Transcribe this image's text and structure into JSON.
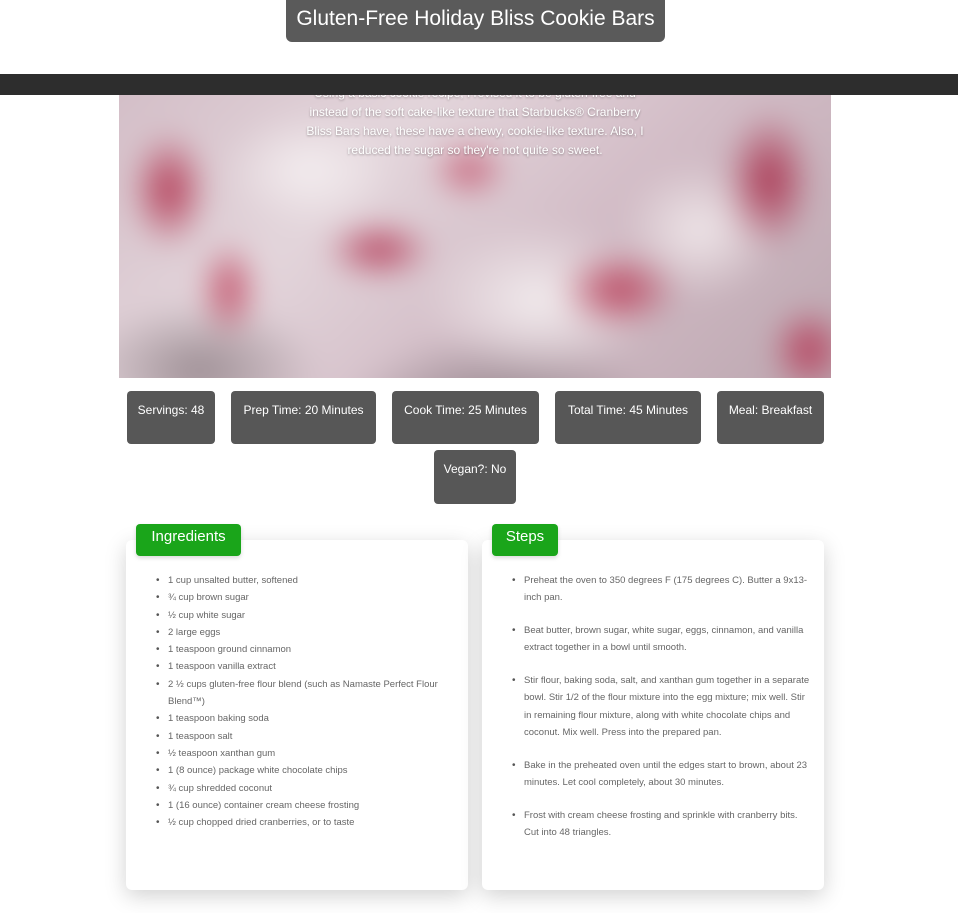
{
  "page_title": "Gluten-Free Holiday Bliss Cookie Bars",
  "description": "Using a basic cookie recipe, I revised it to be gluten-free and instead of the soft cake-like texture that Starbucks® Cranberry Bliss Bars have, these have a chewy, cookie-like texture. Also, I reduced the sugar so they're not quite so sweet.",
  "meta": [
    {
      "label": "Servings: 48"
    },
    {
      "label": "Prep Time: 20 Minutes"
    },
    {
      "label": "Cook Time: 25 Minutes"
    },
    {
      "label": "Total Time: 45 Minutes"
    },
    {
      "label": "Meal: Breakfast"
    },
    {
      "label": "Vegan?: No"
    }
  ],
  "ingredients": {
    "heading": "Ingredients",
    "items": [
      "1 cup unsalted butter, softened",
      "¾ cup brown sugar",
      "½ cup white sugar",
      "2 large eggs",
      "1 teaspoon ground cinnamon",
      "1 teaspoon vanilla extract",
      "2 ½ cups gluten-free flour blend (such as Namaste Perfect Flour Blend™)",
      "1 teaspoon baking soda",
      "1 teaspoon salt",
      "½ teaspoon xanthan gum",
      "1 (8 ounce) package white chocolate chips",
      "¾ cup shredded coconut",
      "1 (16 ounce) container cream cheese frosting",
      "½ cup chopped dried cranberries, or to taste"
    ]
  },
  "steps": {
    "heading": "Steps",
    "items": [
      "Preheat the oven to 350 degrees F (175 degrees C). Butter a 9x13-inch pan.",
      "Beat butter, brown sugar, white sugar, eggs, cinnamon, and vanilla extract together in a bowl until smooth.",
      "Stir flour, baking soda, salt, and xanthan gum together in a separate bowl. Stir 1/2 of the flour mixture into the egg mixture; mix well. Stir in remaining flour mixture, along with white chocolate chips and coconut. Mix well. Press into the prepared pan.",
      "Bake in the preheated oven until the edges start to brown, about 23 minutes. Let cool completely, about 30 minutes.",
      "Frost with cream cheese frosting and sprinkle with cranberry bits. Cut into 48 triangles."
    ]
  },
  "colors": {
    "accent_green": "#1aa51a",
    "badge_gray": "#575757",
    "bar_dark": "#2d2d2d"
  }
}
